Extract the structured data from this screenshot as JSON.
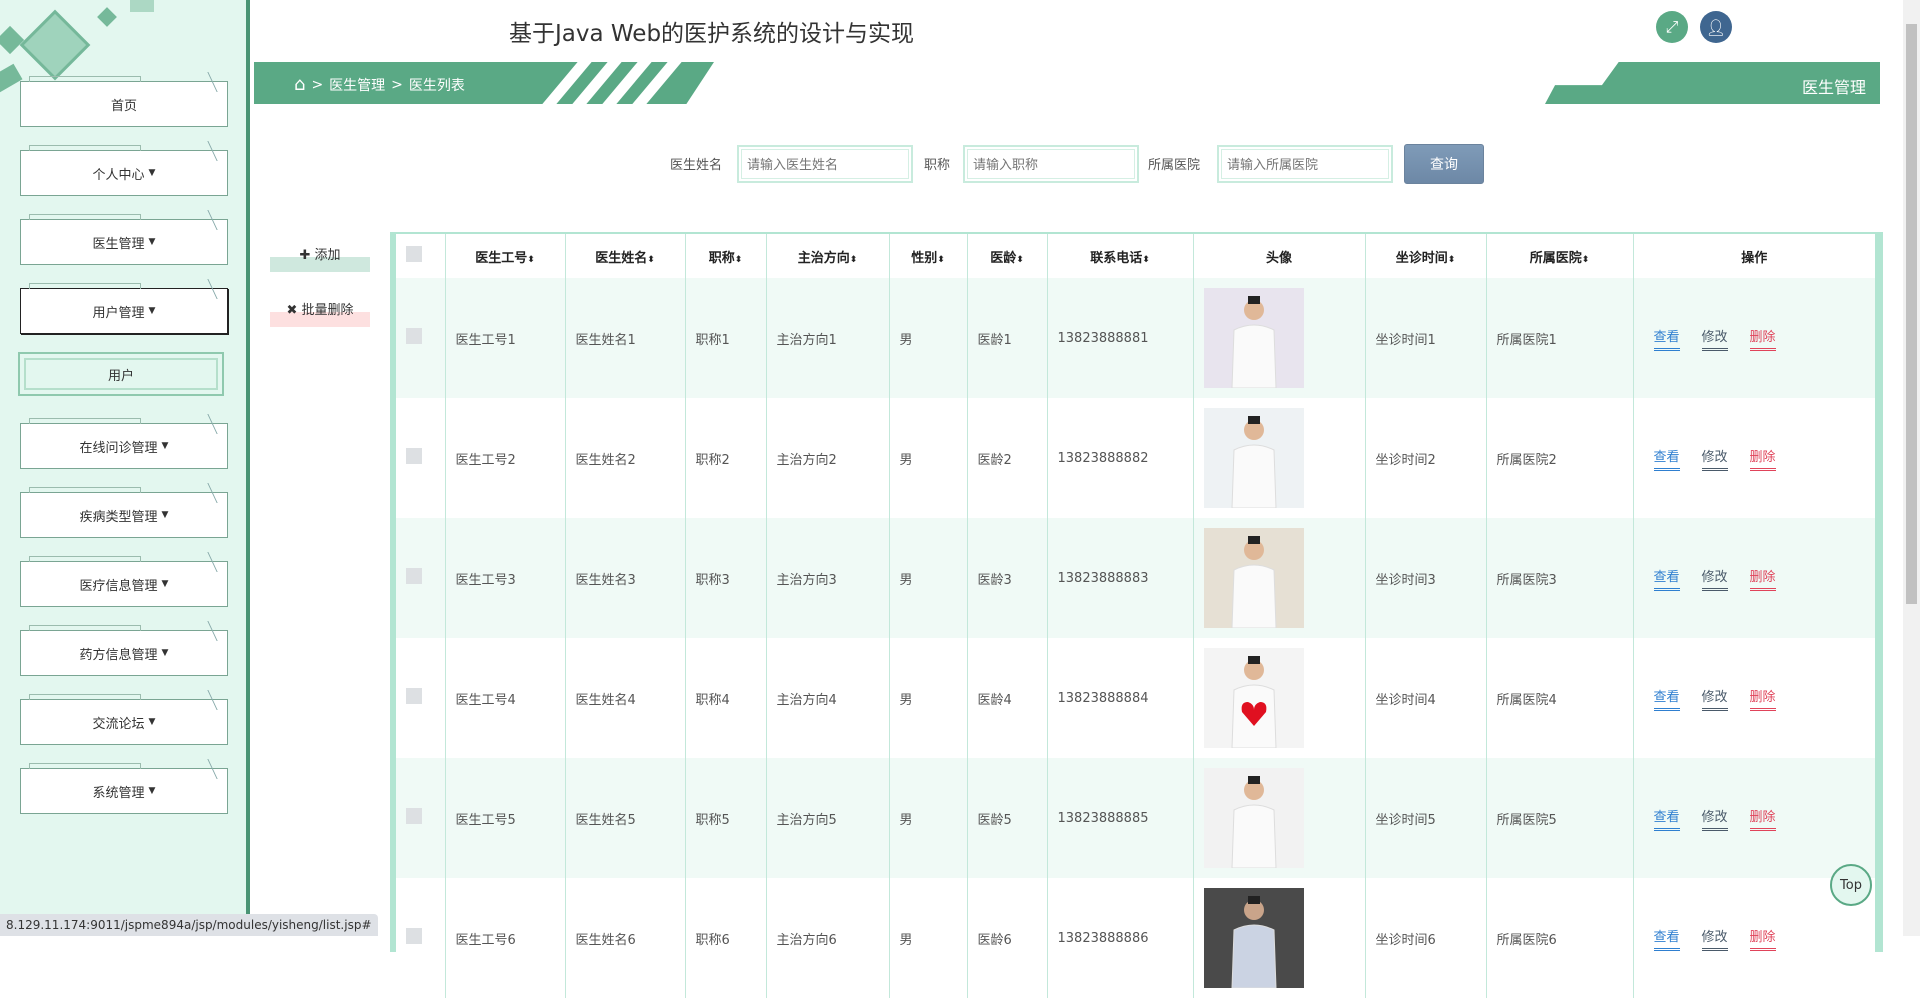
{
  "header": {
    "title": "基于Java Web的医护系统的设计与实现",
    "fullscreen_icon": "expand-icon",
    "user_icon": "user-icon"
  },
  "breadcrumb": {
    "home_icon": "home-icon",
    "items": [
      "医生管理",
      "医生列表"
    ],
    "sep": ">"
  },
  "page_tab": "医生管理",
  "sidebar": {
    "items": [
      {
        "label": "首页",
        "caret": false
      },
      {
        "label": "个人中心",
        "caret": true
      },
      {
        "label": "医生管理",
        "caret": true
      },
      {
        "label": "用户管理",
        "caret": true,
        "active": true
      },
      {
        "label": "在线问诊管理",
        "caret": true
      },
      {
        "label": "疾病类型管理",
        "caret": true
      },
      {
        "label": "医疗信息管理",
        "caret": true
      },
      {
        "label": "药方信息管理",
        "caret": true
      },
      {
        "label": "交流论坛",
        "caret": true
      },
      {
        "label": "系统管理",
        "caret": true
      }
    ],
    "submenu_label": "用户"
  },
  "search": {
    "name_label": "医生姓名",
    "name_placeholder": "请输入医生姓名",
    "title_label": "职称",
    "title_placeholder": "请输入职称",
    "hospital_label": "所属医院",
    "hospital_placeholder": "请输入所属医院",
    "query_button": "查询"
  },
  "actions": {
    "add": "添加",
    "batch_delete": "批量删除"
  },
  "table": {
    "columns": [
      "医生工号",
      "医生姓名",
      "职称",
      "主治方向",
      "性别",
      "医龄",
      "联系电话",
      "头像",
      "坐诊时间",
      "所属医院",
      "操作"
    ],
    "sortable": [
      true,
      true,
      true,
      true,
      true,
      true,
      true,
      false,
      true,
      true,
      false
    ],
    "row_actions": {
      "view": "查看",
      "edit": "修改",
      "delete": "删除"
    },
    "rows": [
      [
        "医生工号1",
        "医生姓名1",
        "职称1",
        "主治方向1",
        "男",
        "医龄1",
        "13823888881",
        "坐诊时间1",
        "所属医院1"
      ],
      [
        "医生工号2",
        "医生姓名2",
        "职称2",
        "主治方向2",
        "男",
        "医龄2",
        "13823888882",
        "坐诊时间2",
        "所属医院2"
      ],
      [
        "医生工号3",
        "医生姓名3",
        "职称3",
        "主治方向3",
        "男",
        "医龄3",
        "13823888883",
        "坐诊时间3",
        "所属医院3"
      ],
      [
        "医生工号4",
        "医生姓名4",
        "职称4",
        "主治方向4",
        "男",
        "医龄4",
        "13823888884",
        "坐诊时间4",
        "所属医院4"
      ],
      [
        "医生工号5",
        "医生姓名5",
        "职称5",
        "主治方向5",
        "男",
        "医龄5",
        "13823888885",
        "坐诊时间5",
        "所属医院5"
      ],
      [
        "医生工号6",
        "医生姓名6",
        "职称6",
        "主治方向6",
        "男",
        "医龄6",
        "13823888886",
        "坐诊时间6",
        "所属医院6"
      ]
    ]
  },
  "status_url": "8.129.11.174:9011/jspme894a/jsp/modules/yisheng/list.jsp#",
  "top_button": "Top",
  "colors": {
    "accent": "#5aa985",
    "view": "#2f7fd0",
    "edit": "#4a5a6a",
    "delete": "#e0435a",
    "add_bg": "#cfe8de",
    "delete_bg": "#fde0e0"
  }
}
